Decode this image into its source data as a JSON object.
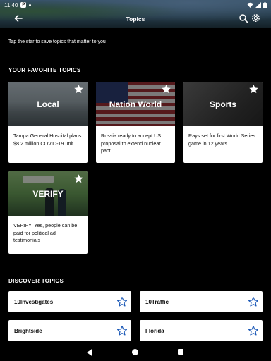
{
  "status_bar": {
    "time": "11:40",
    "app_glyph": "P"
  },
  "header": {
    "title": "Topics"
  },
  "hint": "Tap the star to save topics that matter to you",
  "favorites": {
    "section_title": "YOUR FAVORITE TOPICS",
    "items": [
      {
        "name": "Local",
        "headline": "Tampa General Hospital plans $8.2 million COVID-19 unit",
        "starred": true
      },
      {
        "name": "Nation World",
        "headline": "Russia ready to accept US proposal to extend nuclear pact",
        "starred": true
      },
      {
        "name": "Sports",
        "headline": "Rays set for first World Series game in 12 years",
        "starred": true
      },
      {
        "name": "VERIFY",
        "headline": "VERIFY: Yes, people can be paid for political ad testimonials",
        "starred": true
      }
    ]
  },
  "discover": {
    "section_title": "DISCOVER TOPICS",
    "items": [
      {
        "name": "10Investigates",
        "starred": false
      },
      {
        "name": "10Traffic",
        "starred": false
      },
      {
        "name": "Brightside",
        "starred": false
      },
      {
        "name": "Florida",
        "starred": false
      }
    ]
  },
  "colors": {
    "background": "#000000",
    "card": "#ffffff",
    "star_outline": "#1e5bb8"
  },
  "icons": [
    "back-arrow-icon",
    "search-icon",
    "gear-icon",
    "star-filled-icon",
    "star-outline-icon",
    "wifi-icon",
    "signal-icon",
    "battery-icon"
  ]
}
